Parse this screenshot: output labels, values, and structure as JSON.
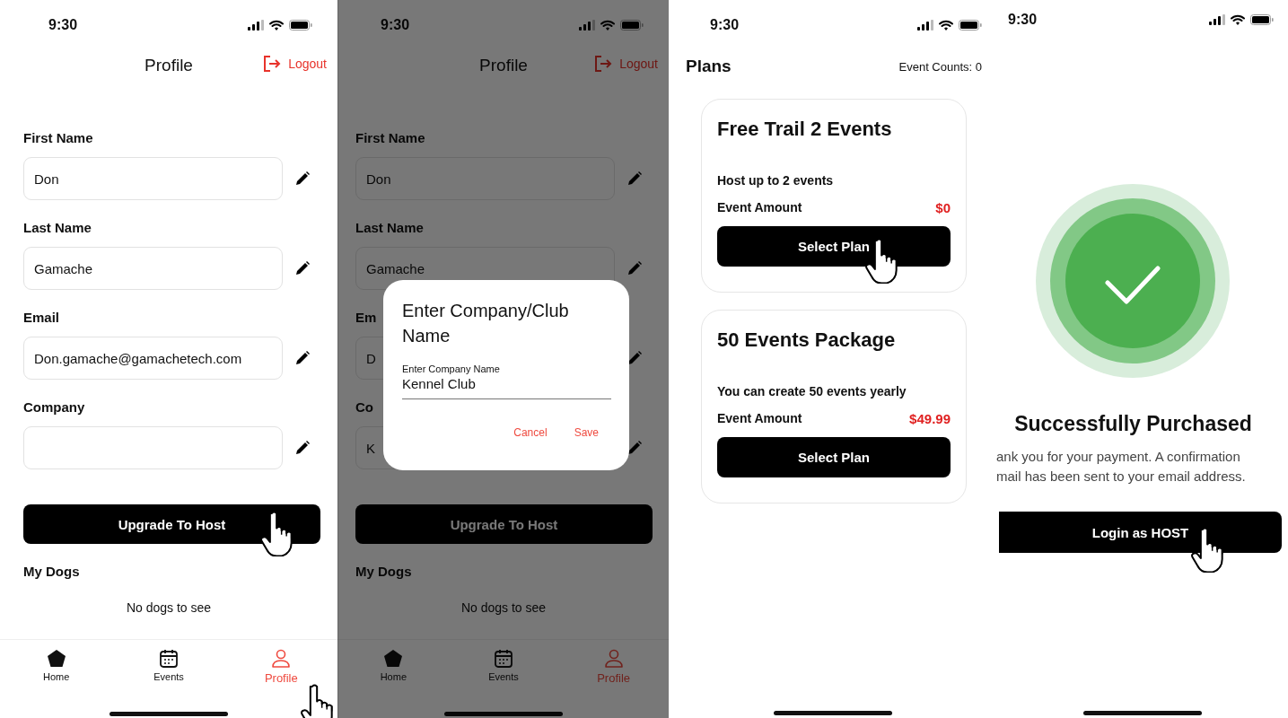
{
  "screens": [
    {
      "kind": "profile",
      "status_bar": {
        "time": "9:30"
      },
      "title": "Profile",
      "logout": "Logout",
      "fields": [
        {
          "label": "First Name",
          "value": "Don"
        },
        {
          "label": "Last Name",
          "value": "Gamache"
        },
        {
          "label": "Email",
          "value": "Don.gamache@gamachetech.com"
        },
        {
          "label": "Company"
        }
      ],
      "upgrade_button": {
        "label": "Upgrade To Host",
        "tapped": true
      },
      "section": "My Dogs",
      "empty_message": "No dogs to see",
      "tabs": [
        {
          "label": "Home",
          "selected": false,
          "tapped": false
        },
        {
          "label": "Events",
          "selected": false,
          "tapped": false
        },
        {
          "label": "Profile",
          "selected": true,
          "tapped": true
        }
      ]
    },
    {
      "kind": "profile",
      "status_bar": {
        "time": "9:30"
      },
      "title": "Profile",
      "logout": "Logout",
      "fields": [
        {
          "label": "First Name",
          "value": "Don"
        },
        {
          "label": "Last Name",
          "value": "Gamache"
        },
        {
          "label": "Em",
          "value": "D"
        },
        {
          "label": "Co",
          "value": "K"
        }
      ],
      "upgrade_button": {
        "label": "Upgrade To Host",
        "tapped": false
      },
      "section": "My Dogs",
      "empty_message": "No dogs to see",
      "tabs": [
        {
          "label": "Home",
          "selected": false,
          "tapped": false
        },
        {
          "label": "Events",
          "selected": false,
          "tapped": false
        },
        {
          "label": "Profile",
          "selected": true,
          "tapped": false
        }
      ],
      "dialog": {
        "title": "Enter Company/Club Name",
        "field_label": "Enter Company Name",
        "field_value": "Kennel Club",
        "buttons": [
          "Cancel",
          "Save"
        ]
      }
    },
    {
      "kind": "plans",
      "status_bar": {
        "time": "9:30"
      },
      "title": "Plans",
      "event_counts": "Event Counts: 0",
      "plans": [
        {
          "name": "Free Trail 2 Events",
          "description": "Host up to 2 events",
          "amount_label": "Event Amount",
          "amount": "$0",
          "button": "Select Plan",
          "tapped": true
        },
        {
          "name": "50 Events Package",
          "description": "You can create 50 events yearly",
          "amount_label": "Event Amount",
          "amount": "$49.99",
          "button": "Select Plan",
          "tapped": false
        }
      ]
    },
    {
      "kind": "success",
      "status_bar": {
        "time": "9:30"
      },
      "title": "Successfully Purchased",
      "message_lines": [
        "ank you for your payment. A confirmation",
        "mail has been sent to your email address."
      ],
      "button": {
        "label": "Login as HOST",
        "tapped": true
      }
    }
  ]
}
